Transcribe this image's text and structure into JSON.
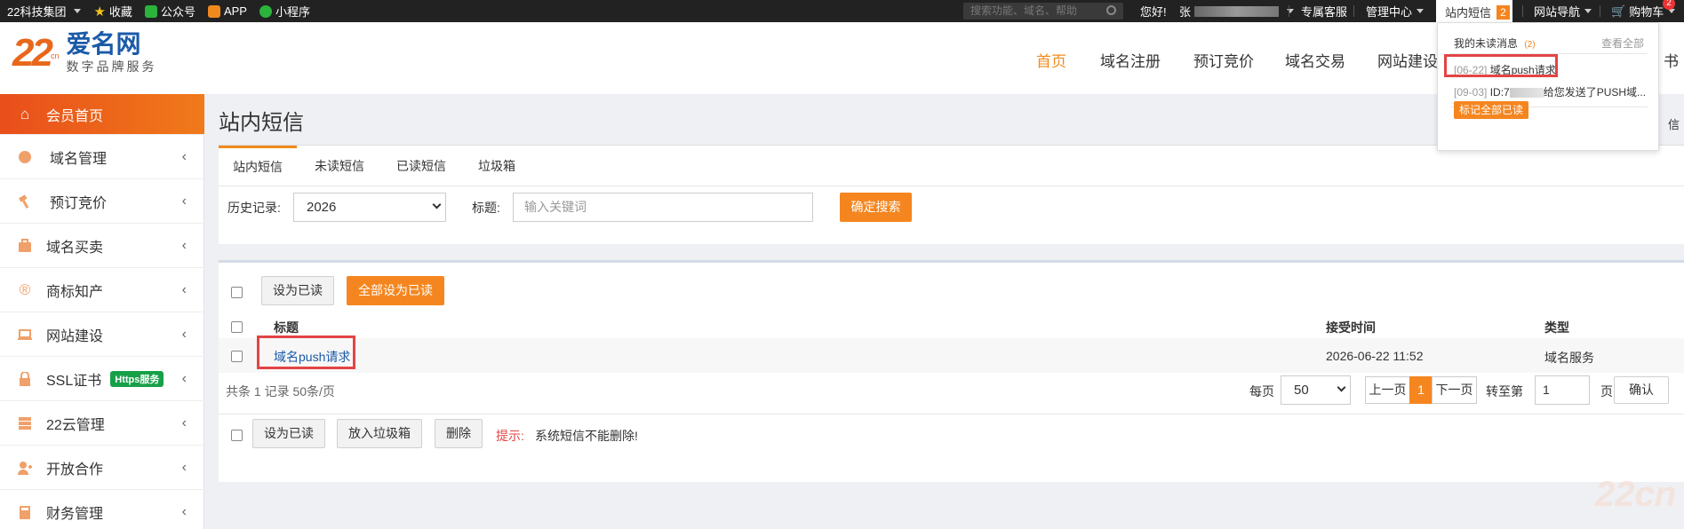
{
  "topbar": {
    "group_label": "22科技集团",
    "fav": "收藏",
    "wechat": "公众号",
    "app": "APP",
    "mini": "小程序",
    "search_placeholder": "搜索功能、域名、帮助",
    "greeting": "您好!",
    "user_prefix": "张",
    "service": "专属客服",
    "admin": "管理中心",
    "messages": "站内短信",
    "messages_count": "2",
    "site_nav": "网站导航",
    "cart": "购物车",
    "cart_count": "2"
  },
  "logo": {
    "num": "22",
    "cn": "cn",
    "name": "爱名网",
    "slogan": "数字品牌服务"
  },
  "nav": {
    "home": "首页",
    "domain_reg": "域名注册",
    "bid": "预订竞价",
    "trade": "域名交易",
    "site": "网站建设",
    "cut": "书"
  },
  "sidebar": {
    "items": [
      {
        "label": "会员首页"
      },
      {
        "label": "域名管理"
      },
      {
        "label": "预订竞价"
      },
      {
        "label": "域名买卖"
      },
      {
        "label": "商标知产"
      },
      {
        "label": "网站建设"
      },
      {
        "label": "SSL证书",
        "badge": "Https服务"
      },
      {
        "label": "22云管理"
      },
      {
        "label": "开放合作"
      },
      {
        "label": "财务管理"
      }
    ]
  },
  "page": {
    "title": "站内短信",
    "side_cut": "信"
  },
  "tabs": [
    "站内短信",
    "未读短信",
    "已读短信",
    "垃圾箱"
  ],
  "filter": {
    "history_label": "历史记录:",
    "year": "2026",
    "title_label": "标题:",
    "keyword_placeholder": "输入关键词",
    "search_btn": "确定搜索"
  },
  "list": {
    "mark_read": "设为已读",
    "mark_all_read": "全部设为已读",
    "col_title": "标题",
    "col_time": "接受时间",
    "col_type": "类型",
    "rows": [
      {
        "title": "域名push请求",
        "time": "2026-06-22 11:52",
        "type": "域名服务"
      }
    ],
    "summary": "共条 1 记录 50条/页",
    "per_page_label": "每页",
    "per_page": "50",
    "prev": "上一页",
    "page": "1",
    "next": "下一页",
    "goto_label": "转至第",
    "goto_value": "1",
    "page_unit": "页",
    "confirm": "确认",
    "bottom_mark_read": "设为已读",
    "trash": "放入垃圾箱",
    "delete": "删除",
    "hint_label": "提示:",
    "hint_text": "系统短信不能删除!"
  },
  "dropdown": {
    "head": "我的未读消息",
    "count": "(2)",
    "view_all": "查看全部",
    "items": [
      {
        "date": "[06-22]",
        "text": "域名push请求"
      },
      {
        "date": "[09-03]",
        "text": "ID:7",
        "rest": "给您发送了PUSH域..."
      }
    ],
    "mark_all": "标记全部已读"
  },
  "watermark": "22cn",
  "colors": {
    "accent": "#f5861f",
    "sidebar_active": "#e94e1b",
    "link": "#1a5aa8",
    "highlight_box": "#e34444"
  }
}
